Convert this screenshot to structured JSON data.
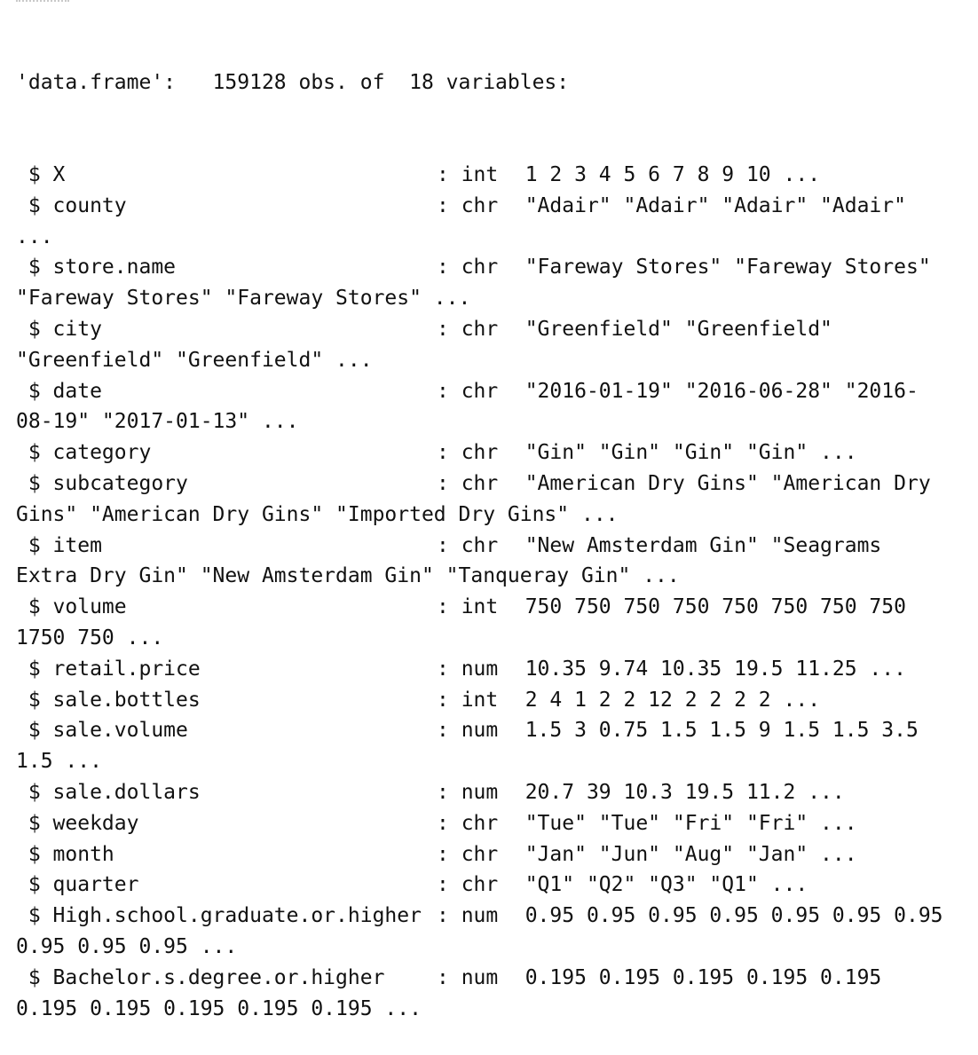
{
  "header": {
    "text": "'data.frame':   159128 obs. of  18 variables:"
  },
  "variables": [
    {
      "prefix": " $ ",
      "name": "X",
      "sep": ": ",
      "type": "int",
      "values": "1 2 3 4 5 6 7 8 9 10 ...",
      "cont": ""
    },
    {
      "prefix": " $ ",
      "name": "county",
      "sep": ": ",
      "type": "chr",
      "values": "\"Adair\" \"Adair\" \"Adair\" \"Adair\"",
      "cont": "..."
    },
    {
      "prefix": " $ ",
      "name": "store.name",
      "sep": ": ",
      "type": "chr",
      "values": "\"Fareway Stores\" \"Fareway Stores\"",
      "cont": "\"Fareway Stores\" \"Fareway Stores\" ..."
    },
    {
      "prefix": " $ ",
      "name": "city",
      "sep": ": ",
      "type": "chr",
      "values": "\"Greenfield\" \"Greenfield\"",
      "cont": "\"Greenfield\" \"Greenfield\" ..."
    },
    {
      "prefix": " $ ",
      "name": "date",
      "sep": ": ",
      "type": "chr",
      "values": "\"2016-01-19\" \"2016-06-28\" \"2016-",
      "cont": "08-19\" \"2017-01-13\" ..."
    },
    {
      "prefix": " $ ",
      "name": "category",
      "sep": ": ",
      "type": "chr",
      "values": "\"Gin\" \"Gin\" \"Gin\" \"Gin\" ...",
      "cont": ""
    },
    {
      "prefix": " $ ",
      "name": "subcategory",
      "sep": ": ",
      "type": "chr",
      "values": "\"American Dry Gins\" \"American Dry",
      "cont": "Gins\" \"American Dry Gins\" \"Imported Dry Gins\" ..."
    },
    {
      "prefix": " $ ",
      "name": "item",
      "sep": ": ",
      "type": "chr",
      "values": "\"New Amsterdam Gin\" \"Seagrams",
      "cont": "Extra Dry Gin\" \"New Amsterdam Gin\" \"Tanqueray Gin\" ..."
    },
    {
      "prefix": " $ ",
      "name": "volume",
      "sep": ": ",
      "type": "int",
      "values": "750 750 750 750 750 750 750 750",
      "cont": "1750 750 ..."
    },
    {
      "prefix": " $ ",
      "name": "retail.price",
      "sep": ": ",
      "type": "num",
      "values": "10.35 9.74 10.35 19.5 11.25 ...",
      "cont": ""
    },
    {
      "prefix": " $ ",
      "name": "sale.bottles",
      "sep": ": ",
      "type": "int",
      "values": "2 4 1 2 2 12 2 2 2 2 ...",
      "cont": ""
    },
    {
      "prefix": " $ ",
      "name": "sale.volume",
      "sep": ": ",
      "type": "num",
      "values": "1.5 3 0.75 1.5 1.5 9 1.5 1.5 3.5",
      "cont": "1.5 ..."
    },
    {
      "prefix": " $ ",
      "name": "sale.dollars",
      "sep": ": ",
      "type": "num",
      "values": "20.7 39 10.3 19.5 11.2 ...",
      "cont": ""
    },
    {
      "prefix": " $ ",
      "name": "weekday",
      "sep": ": ",
      "type": "chr",
      "values": "\"Tue\" \"Tue\" \"Fri\" \"Fri\" ...",
      "cont": ""
    },
    {
      "prefix": " $ ",
      "name": "month",
      "sep": ": ",
      "type": "chr",
      "values": "\"Jan\" \"Jun\" \"Aug\" \"Jan\" ...",
      "cont": ""
    },
    {
      "prefix": " $ ",
      "name": "quarter",
      "sep": ": ",
      "type": "chr",
      "values": "\"Q1\" \"Q2\" \"Q3\" \"Q1\" ...",
      "cont": ""
    },
    {
      "prefix": " $ ",
      "name": "High.school.graduate.or.higher",
      "sep": ": ",
      "type": "num",
      "values": "0.95 0.95 0.95 0.95 0.95 0.95 0.95",
      "cont": "0.95 0.95 0.95 ..."
    },
    {
      "prefix": " $ ",
      "name": "Bachelor.s.degree.or.higher",
      "sep": ": ",
      "type": "num",
      "values": "0.195 0.195 0.195 0.195 0.195",
      "cont": "0.195 0.195 0.195 0.195 0.195 ..."
    }
  ]
}
